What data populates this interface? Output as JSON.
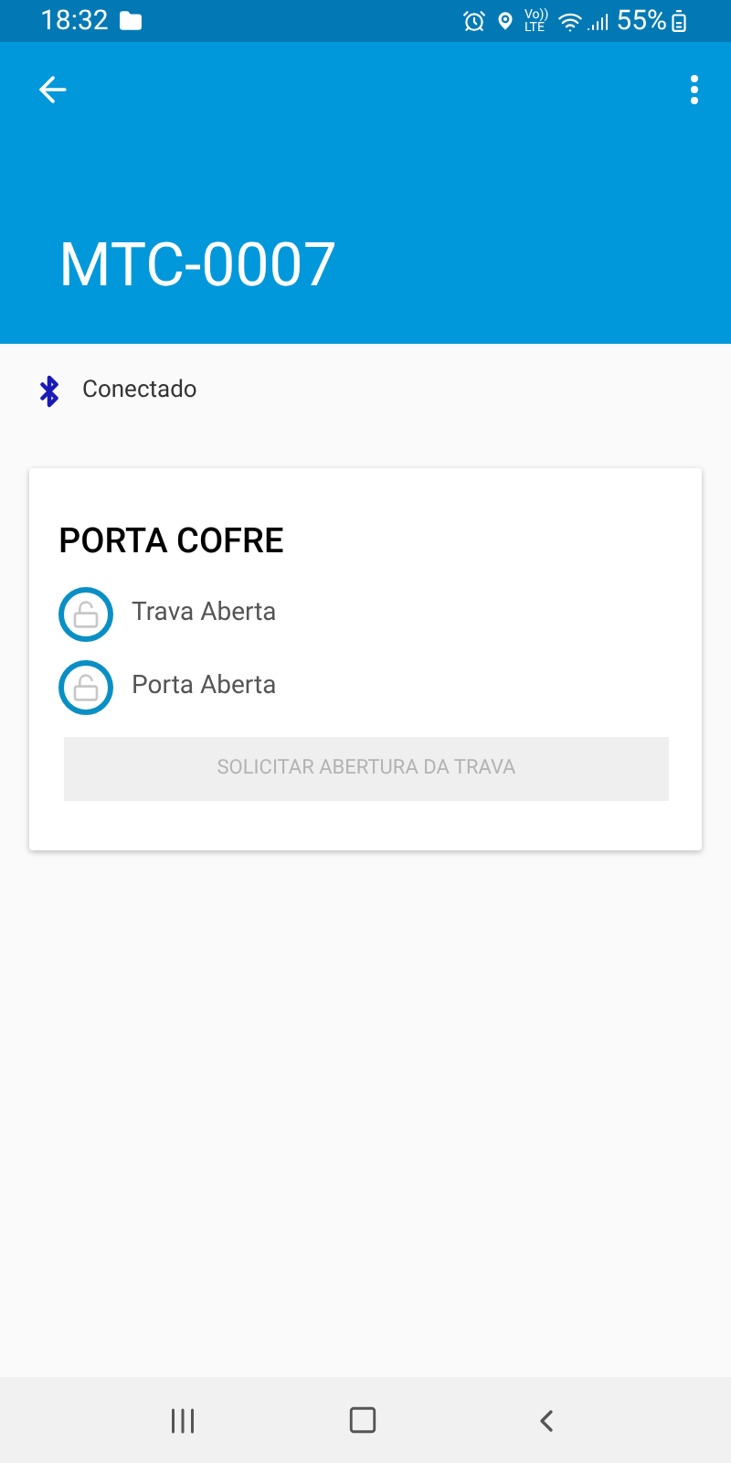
{
  "status_bar": {
    "time": "18:32",
    "volte_top": "Vo))",
    "volte_bottom": "LTE",
    "battery": "55%"
  },
  "app_bar": {
    "title": "MTC-0007"
  },
  "connection": {
    "label": "Conectado"
  },
  "card": {
    "title": "PORTA COFRE",
    "items": [
      {
        "label": "Trava Aberta"
      },
      {
        "label": "Porta Aberta"
      }
    ],
    "button": {
      "label": "SOLICITAR ABERTURA DA TRAVA",
      "disabled": true
    }
  }
}
